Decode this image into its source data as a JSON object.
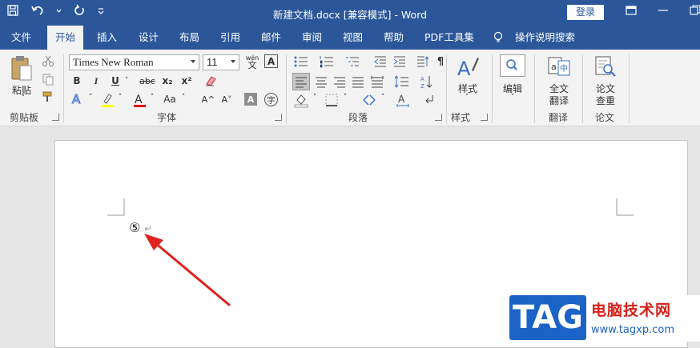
{
  "window": {
    "title": "新建文档.docx [兼容模式]  -  Word",
    "login_label": "登录"
  },
  "tabs": [
    {
      "label": "文件"
    },
    {
      "label": "开始"
    },
    {
      "label": "插入"
    },
    {
      "label": "设计"
    },
    {
      "label": "布局"
    },
    {
      "label": "引用"
    },
    {
      "label": "邮件"
    },
    {
      "label": "审阅"
    },
    {
      "label": "视图"
    },
    {
      "label": "帮助"
    },
    {
      "label": "PDF工具集"
    },
    {
      "label": "操作说明搜索"
    }
  ],
  "active_tab": "开始",
  "ribbon": {
    "clipboard": {
      "group_label": "剪贴板",
      "paste_label": "粘贴"
    },
    "font": {
      "group_label": "字体",
      "font_name": "Times New Roman",
      "font_size": "11",
      "bold": "B",
      "italic": "I",
      "underline": "U",
      "strike": "abc",
      "subscript": "x₂",
      "superscript": "x²",
      "grow": "A^",
      "shrink": "A˅",
      "change_case": "Aa",
      "wen_label": "wén"
    },
    "paragraph": {
      "group_label": "段落"
    },
    "styles": {
      "group_label": "样式",
      "button_label": "样式"
    },
    "editing": {
      "button_label": "编辑"
    },
    "translate": {
      "group_label": "翻译",
      "button_label_1": "全文",
      "button_label_2": "翻译"
    },
    "paper": {
      "group_label": "论文",
      "button_label_1": "论文",
      "button_label_2": "查重"
    }
  },
  "document": {
    "content": "⑤",
    "para_mark": "↵"
  },
  "watermark": {
    "tag": "TAG",
    "site_name": "电脑技术网",
    "url": "www.tagxp.com"
  },
  "colors": {
    "accent": "#2b579a",
    "arrow": "#e0231f",
    "highlight_yellow": "#ffff00",
    "font_red": "#e00000"
  }
}
